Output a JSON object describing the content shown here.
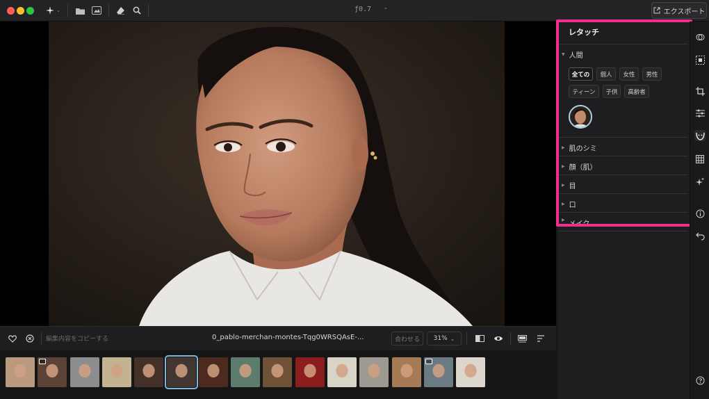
{
  "window": {
    "title": "ƒ0.7",
    "title_suffix": "-",
    "export_label": "エクスポート"
  },
  "colors": {
    "traffic_close": "#fe5f57",
    "traffic_min": "#febc2e",
    "traffic_max": "#28c840",
    "highlight_frame": "#ee2f8e",
    "selected_thumb": "#7fb6d6"
  },
  "toolbar_icons": [
    "ai-sparkle-icon",
    "folder-icon",
    "image-library-icon",
    "eraser-icon",
    "magic-search-icon"
  ],
  "bottom_bar": {
    "copy_edits_placeholder": "編集内容をコピーする",
    "filename": "0_pablo-merchan-montes-Tqg0WRSQAsE-...",
    "fit_label": "合わせる",
    "zoom_label": "31%",
    "zoom_chevron": "⌄"
  },
  "panel": {
    "title": "レタッチ",
    "section_person": "人間",
    "chips_row1": [
      "全ての",
      "個人",
      "女性",
      "男性"
    ],
    "chips_row2": [
      "ティーン",
      "子供",
      "高齢者"
    ],
    "active_chip": "全ての",
    "sections": [
      "肌のシミ",
      "顔（肌）",
      "目",
      "口",
      "メイク"
    ]
  },
  "filmstrip": {
    "selected_index": 5,
    "thumbs": [
      {
        "bg": "#b99a7e",
        "badge": false
      },
      {
        "bg": "#5b4136",
        "badge": true
      },
      {
        "bg": "#8c8d8e",
        "badge": false
      },
      {
        "bg": "#c2b391",
        "badge": false
      },
      {
        "bg": "#433029",
        "badge": false
      },
      {
        "bg": "#413630",
        "badge": false
      },
      {
        "bg": "#4c2a1e",
        "badge": false
      },
      {
        "bg": "#5d7c6e",
        "badge": false
      },
      {
        "bg": "#6e5238",
        "badge": false
      },
      {
        "bg": "#8a1e1e",
        "badge": false
      },
      {
        "bg": "#d9d4c8",
        "badge": false
      },
      {
        "bg": "#9e9a92",
        "badge": false
      },
      {
        "bg": "#a57a55",
        "badge": false
      },
      {
        "bg": "#6b7b84",
        "badge": true
      },
      {
        "bg": "#dcd6cc",
        "badge": false
      }
    ]
  },
  "right_rail_icons": [
    "mask-icon",
    "select-subject-icon",
    "crop-icon",
    "adjust-sliders-icon",
    "retouch-face-icon",
    "grid-icon",
    "sparkle-icon",
    "info-icon",
    "undo-icon",
    "help-icon"
  ],
  "right_rail_active": "retouch-face-icon"
}
